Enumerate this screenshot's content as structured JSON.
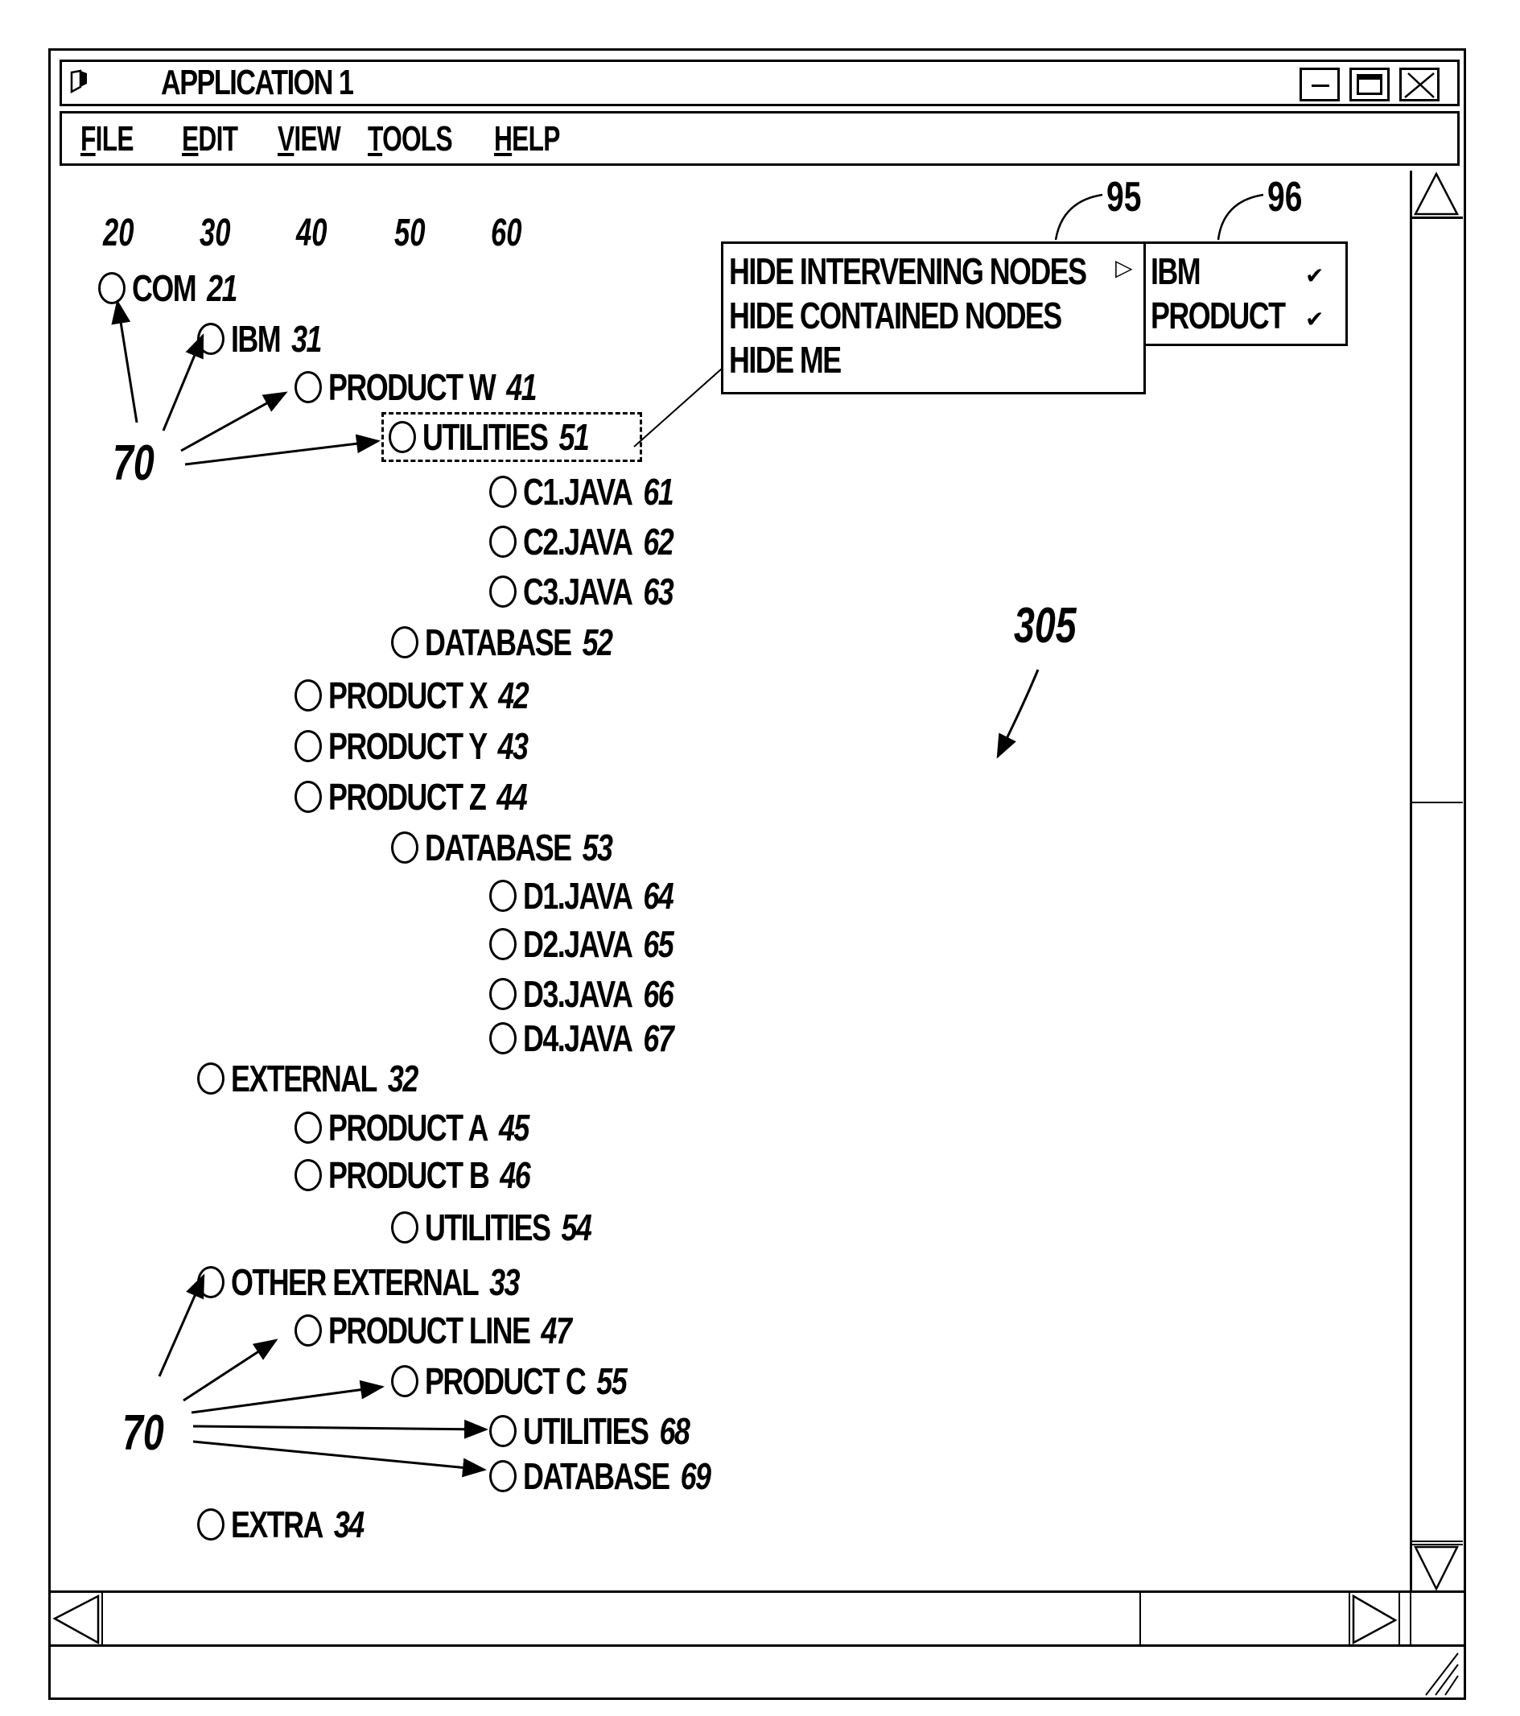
{
  "window": {
    "title": "APPLICATION 1",
    "icon": "app-icon",
    "controls": [
      "minimize",
      "maximize",
      "close"
    ]
  },
  "menubar": {
    "items": [
      {
        "label": "FILE",
        "mnemonic": "F",
        "rest": "ILE"
      },
      {
        "label": "EDIT",
        "mnemonic": "E",
        "rest": "DIT"
      },
      {
        "label": "VIEW",
        "mnemonic": "V",
        "rest": "IEW"
      },
      {
        "label": "TOOLS",
        "mnemonic": "T",
        "rest": "OOLS"
      },
      {
        "label": "HELP",
        "mnemonic": "H",
        "rest": "ELP"
      }
    ]
  },
  "column_headers": [
    "20",
    "30",
    "40",
    "50",
    "60"
  ],
  "tree": [
    {
      "label": "COM",
      "ref": "21",
      "level": 0
    },
    {
      "label": "IBM",
      "ref": "31",
      "level": 1
    },
    {
      "label": "PRODUCT W",
      "ref": "41",
      "level": 2
    },
    {
      "label": "UTILITIES",
      "ref": "51",
      "level": 3,
      "selected": true
    },
    {
      "label": "C1.JAVA",
      "ref": "61",
      "level": 4
    },
    {
      "label": "C2.JAVA",
      "ref": "62",
      "level": 4
    },
    {
      "label": "C3.JAVA",
      "ref": "63",
      "level": 4
    },
    {
      "label": "DATABASE",
      "ref": "52",
      "level": 3
    },
    {
      "label": "PRODUCT X",
      "ref": "42",
      "level": 2
    },
    {
      "label": "PRODUCT Y",
      "ref": "43",
      "level": 2
    },
    {
      "label": "PRODUCT Z",
      "ref": "44",
      "level": 2
    },
    {
      "label": "DATABASE",
      "ref": "53",
      "level": 3
    },
    {
      "label": "D1.JAVA",
      "ref": "64",
      "level": 4
    },
    {
      "label": "D2.JAVA",
      "ref": "65",
      "level": 4
    },
    {
      "label": "D3.JAVA",
      "ref": "66",
      "level": 4
    },
    {
      "label": "D4.JAVA",
      "ref": "67",
      "level": 4
    },
    {
      "label": "EXTERNAL",
      "ref": "32",
      "level": 1
    },
    {
      "label": "PRODUCT A",
      "ref": "45",
      "level": 2
    },
    {
      "label": "PRODUCT B",
      "ref": "46",
      "level": 2
    },
    {
      "label": "UTILITIES",
      "ref": "54",
      "level": 3
    },
    {
      "label": "OTHER EXTERNAL",
      "ref": "33",
      "level": 1
    },
    {
      "label": "PRODUCT LINE",
      "ref": "47",
      "level": 2
    },
    {
      "label": "PRODUCT C",
      "ref": "55",
      "level": 3
    },
    {
      "label": "UTILITIES",
      "ref": "68",
      "level": 4
    },
    {
      "label": "DATABASE",
      "ref": "69",
      "level": 4
    },
    {
      "label": "EXTRA",
      "ref": "34",
      "level": 1
    }
  ],
  "context_menu": {
    "ref": "95",
    "items": [
      {
        "label": "HIDE INTERVENING NODES",
        "submenu": true
      },
      {
        "label": "HIDE CONTAINED NODES"
      },
      {
        "label": "HIDE ME"
      }
    ]
  },
  "submenu": {
    "ref": "96",
    "items": [
      {
        "label": "IBM",
        "checked": true
      },
      {
        "label": "PRODUCT",
        "checked": true
      }
    ]
  },
  "annotations": {
    "node_indicator": "70",
    "view_ref": "305",
    "submenu_arrow": "▷",
    "check": "✔"
  }
}
